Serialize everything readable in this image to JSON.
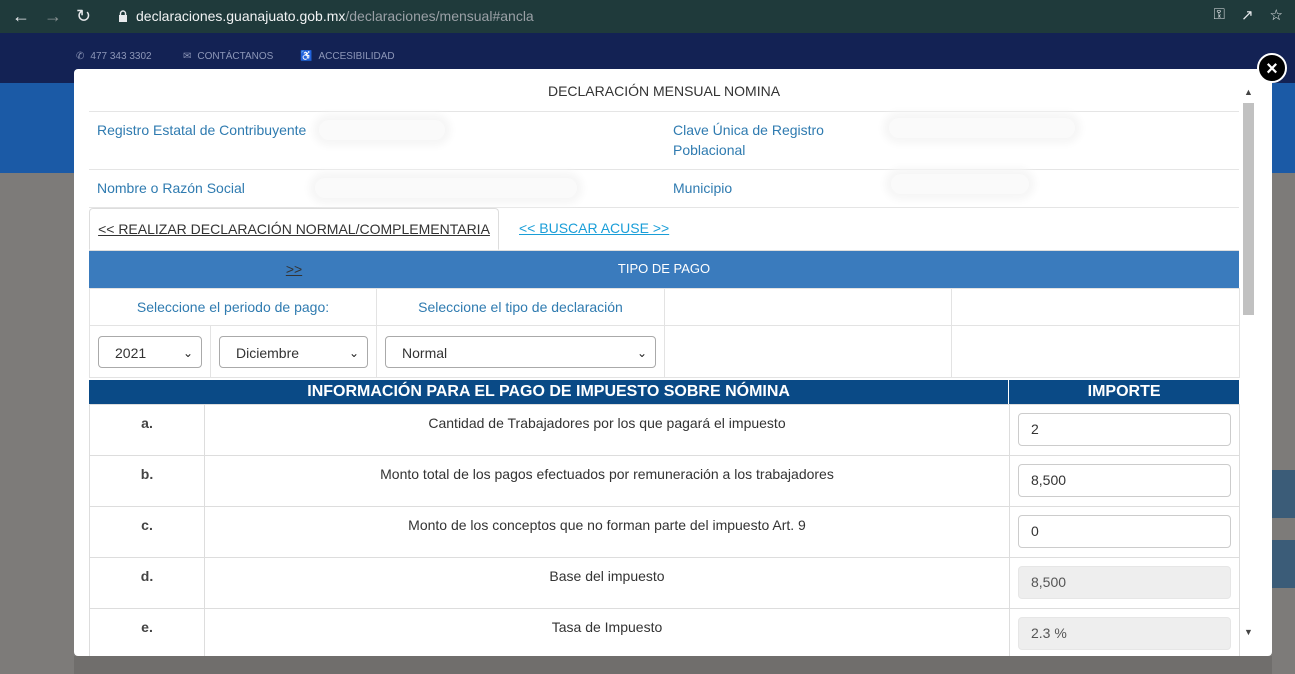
{
  "browser": {
    "url_host": "declaraciones.guanajuato.gob.mx",
    "url_path": "/declaraciones/mensual#ancla"
  },
  "site_topbar": {
    "phone": "477 343 3302",
    "contact": "CONTÁCTANOS",
    "accessibility": "ACCESIBILIDAD"
  },
  "modal": {
    "close_symbol": "×",
    "title": "DECLARACIÓN MENSUAL NOMINA",
    "labels": {
      "rec": "Registro Estatal de Contribuyente",
      "curp_line1": "Clave Única de Registro",
      "curp_line2": "Poblacional",
      "nombre": "Nombre o Razón Social",
      "municipio": "Municipio"
    },
    "tabs": {
      "active": "<< REALIZAR DECLARACIÓN NORMAL/COMPLEMENTARIA >>",
      "link": "<< BUSCAR ACUSE >>"
    },
    "tipo_de_pago": {
      "header": "TIPO DE PAGO",
      "periodo_label": "Seleccione el periodo de pago:",
      "tipo_label": "Seleccione el tipo de declaración",
      "year": "2021",
      "month": "Diciembre",
      "declaration_type": "Normal"
    },
    "impuesto": {
      "header": "INFORMACIÓN PARA EL PAGO DE IMPUESTO SOBRE NÓMINA",
      "importe_header": "IMPORTE",
      "rows": [
        {
          "letter": "a.",
          "desc": "Cantidad de Trabajadores por los que pagará el impuesto",
          "value": "2"
        },
        {
          "letter": "b.",
          "desc": "Monto total de los pagos efectuados por remuneración a los trabajadores",
          "value": "8,500"
        },
        {
          "letter": "c.",
          "desc": "Monto de los conceptos que no forman parte del impuesto Art. 9",
          "value": "0"
        },
        {
          "letter": "d.",
          "desc": "Base del impuesto",
          "value": "8,500"
        },
        {
          "letter": "e.",
          "desc": "Tasa de Impuesto",
          "value": "2.3 %"
        }
      ]
    }
  }
}
